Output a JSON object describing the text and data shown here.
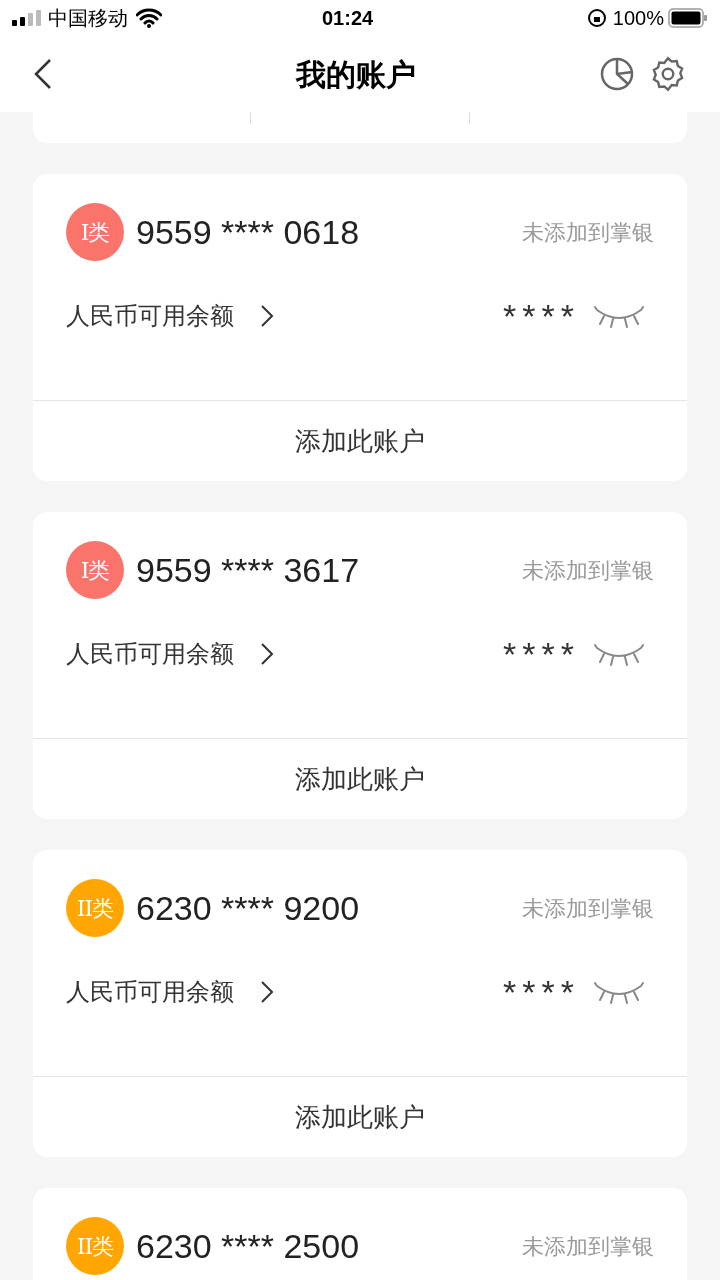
{
  "status_bar": {
    "carrier": "中国移动",
    "time": "01:24",
    "battery": "100%"
  },
  "header": {
    "title": "我的账户"
  },
  "accounts": [
    {
      "badge": "I类",
      "color": "#fa746b",
      "number": "9559 **** 0618",
      "status": "未添加到掌银",
      "balance_label": "人民币可用余额",
      "balance": "****",
      "action": "添加此账户"
    },
    {
      "badge": "I类",
      "color": "#fa746b",
      "number": "9559 **** 3617",
      "status": "未添加到掌银",
      "balance_label": "人民币可用余额",
      "balance": "****",
      "action": "添加此账户"
    },
    {
      "badge": "II类",
      "color": "#ffa602",
      "number": "6230 **** 9200",
      "status": "未添加到掌银",
      "balance_label": "人民币可用余额",
      "balance": "****",
      "action": "添加此账户"
    },
    {
      "badge": "II类",
      "color": "#ffa602",
      "number": "6230 **** 2500",
      "status": "未添加到掌银"
    }
  ]
}
